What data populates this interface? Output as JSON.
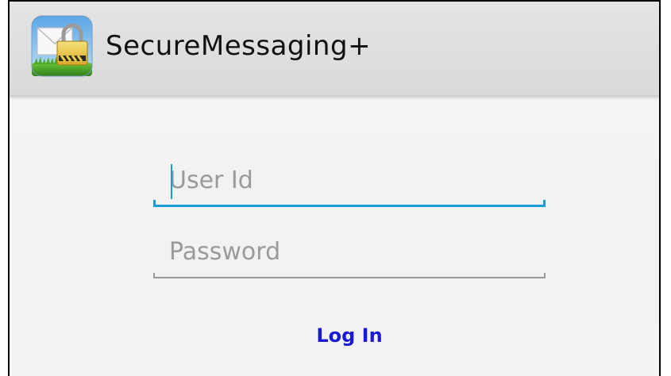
{
  "app": {
    "title": "SecureMessaging+",
    "icon": "envelope-lock-icon"
  },
  "form": {
    "userid": {
      "value": "",
      "placeholder": "User Id"
    },
    "password": {
      "value": "",
      "placeholder": "Password"
    },
    "login_label": "Log In"
  },
  "colors": {
    "accent": "#1a9ad6",
    "button_text": "#1a1ad6",
    "action_bar": "#dadada",
    "background": "#f3f3f3"
  }
}
